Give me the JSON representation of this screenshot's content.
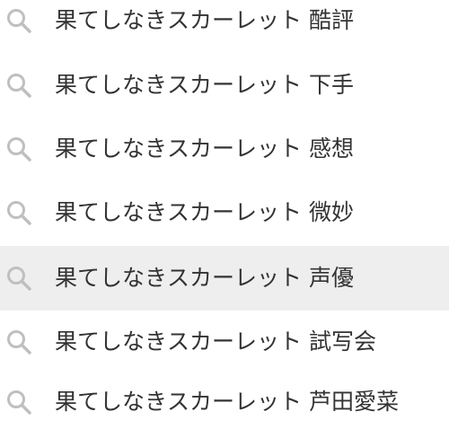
{
  "colors": {
    "text": "#333333",
    "icon": "#bfbfbf",
    "highlight_background": "#eeeeee"
  },
  "suggestions": [
    {
      "icon": "search-icon",
      "label": "果てしなきスカーレット 酷評"
    },
    {
      "icon": "search-icon",
      "label": "果てしなきスカーレット 下手"
    },
    {
      "icon": "search-icon",
      "label": "果てしなきスカーレット 感想"
    },
    {
      "icon": "search-icon",
      "label": "果てしなきスカーレット 微妙"
    },
    {
      "icon": "search-icon",
      "label": "果てしなきスカーレット 声優",
      "highlighted": true
    },
    {
      "icon": "search-icon",
      "label": "果てしなきスカーレット 試写会"
    },
    {
      "icon": "search-icon",
      "label": "果てしなきスカーレット 芦田愛菜"
    }
  ]
}
